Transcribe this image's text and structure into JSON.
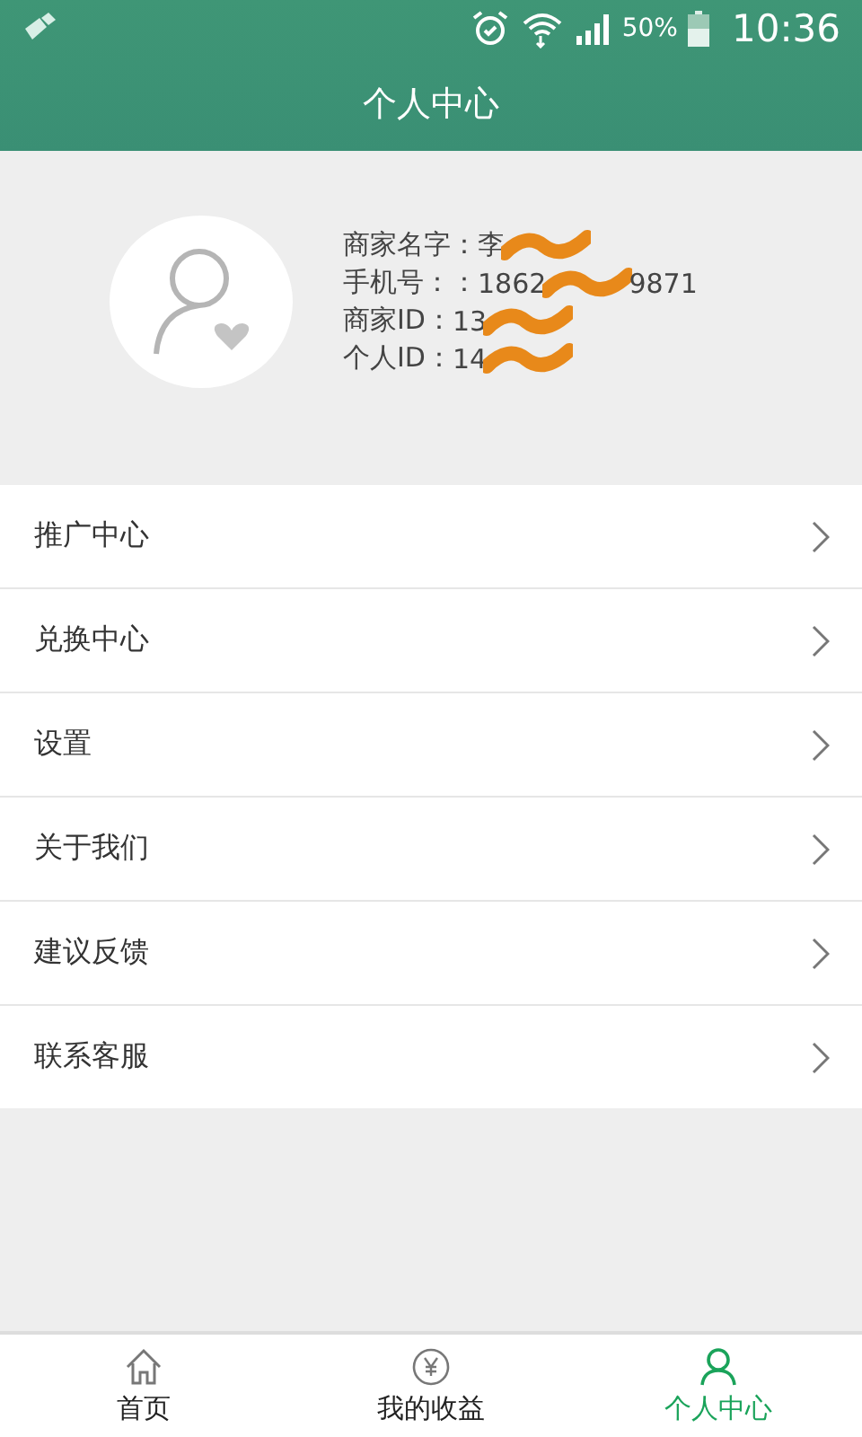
{
  "status_bar": {
    "battery_percent": "50%",
    "time": "10:36"
  },
  "header": {
    "title": "个人中心"
  },
  "profile": {
    "lines": [
      {
        "label": "商家名字：",
        "shown": "李",
        "redacted": true
      },
      {
        "label": "手机号：：",
        "shown": "1862",
        "redacted": true,
        "after": "9871"
      },
      {
        "label": "商家ID：",
        "shown": "13",
        "redacted": true
      },
      {
        "label": "个人ID：",
        "shown": "14",
        "redacted": true
      }
    ]
  },
  "menu": [
    {
      "label": "推广中心"
    },
    {
      "label": "兑换中心"
    },
    {
      "label": "设置"
    },
    {
      "label": "关于我们"
    },
    {
      "label": "建议反馈"
    },
    {
      "label": "联系客服"
    }
  ],
  "bottom_nav": [
    {
      "label": "首页",
      "kind": "home",
      "selected": false
    },
    {
      "label": "我的收益",
      "kind": "earnings",
      "selected": false
    },
    {
      "label": "个人中心",
      "kind": "profile",
      "selected": true
    }
  ]
}
